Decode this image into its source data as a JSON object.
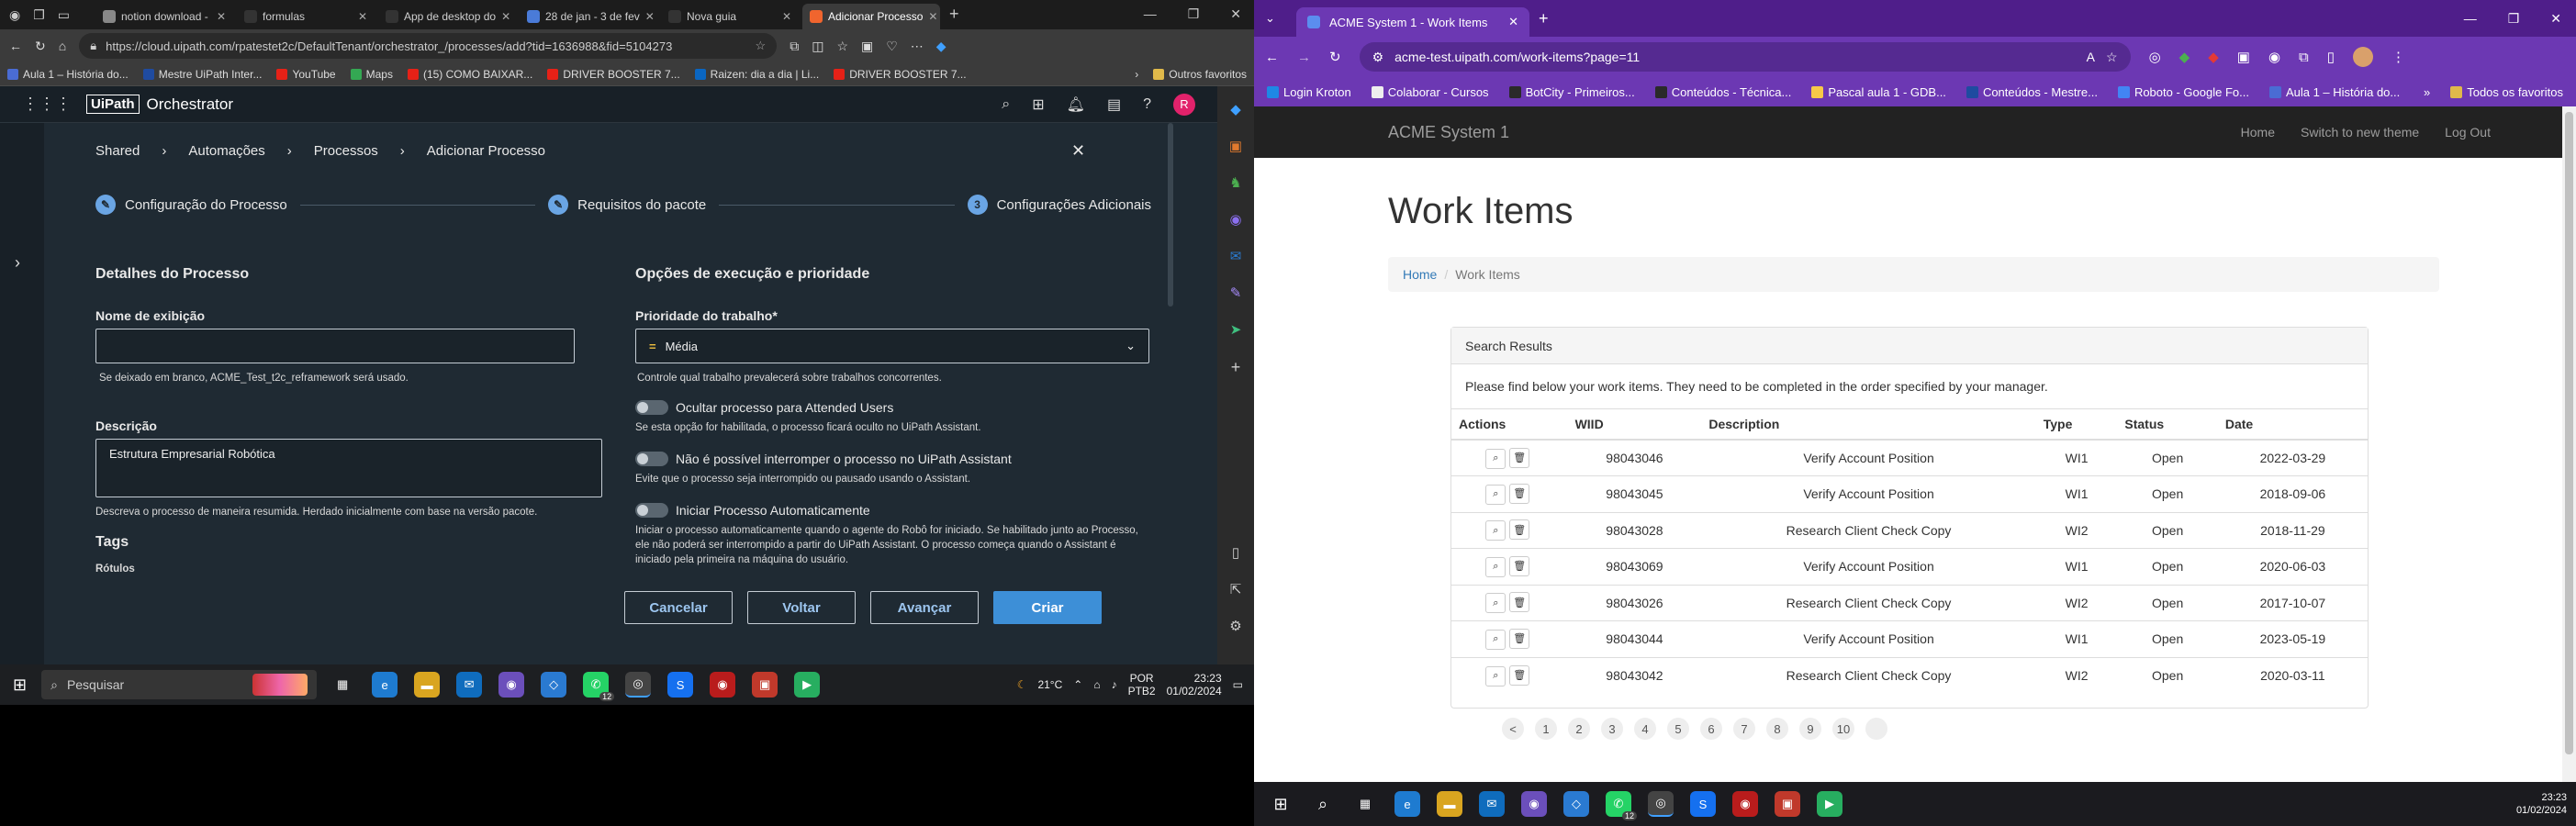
{
  "left": {
    "tabs": [
      {
        "label": "notion download -",
        "color": "#888888",
        "active": false
      },
      {
        "label": "formulas",
        "color": "#333333",
        "active": false
      },
      {
        "label": "App de desktop do",
        "color": "#333333",
        "active": false
      },
      {
        "label": "28 de jan - 3 de fev",
        "color": "#4a7bd8",
        "active": false
      },
      {
        "label": "Nova guia",
        "color": "#333333",
        "active": false
      },
      {
        "label": "Adicionar Processo",
        "color": "#f0652e",
        "active": true
      }
    ],
    "url": "https://cloud.uipath.com/rpatestet2c/DefaultTenant/orchestrator_/processes/add?tid=1636988&fid=5104273",
    "bookmarks": [
      {
        "label": "Aula 1 – História do...",
        "color": "#4a6cd4"
      },
      {
        "label": "Mestre UiPath Inter...",
        "color": "#1f4ba0"
      },
      {
        "label": "YouTube",
        "color": "#e62117"
      },
      {
        "label": "Maps",
        "color": "#34a853"
      },
      {
        "label": "(15) COMO BAIXAR...",
        "color": "#e62117"
      },
      {
        "label": "DRIVER BOOSTER 7...",
        "color": "#e62117"
      },
      {
        "label": "Raizen: dia a dia | Li...",
        "color": "#0a66c2"
      },
      {
        "label": "DRIVER BOOSTER 7...",
        "color": "#e62117"
      }
    ],
    "bookmarks_other": "Outros favoritos",
    "app_logo": "UiPath",
    "app_name": "Orchestrator",
    "avatar": "R",
    "breadcrumb": [
      "Shared",
      "Automações",
      "Processos",
      "Adicionar Processo"
    ],
    "steps": [
      {
        "label": "Configuração do Processo",
        "marker": "✎"
      },
      {
        "label": "Requisitos do pacote",
        "marker": "✎"
      },
      {
        "label": "Configurações Adicionais",
        "marker": "3"
      }
    ],
    "details_title": "Detalhes do Processo",
    "display_name_label": "Nome de exibição",
    "display_name_value": "",
    "display_name_help": "Se deixado em branco, ACME_Test_t2c_reframework será usado.",
    "description_label": "Descrição",
    "description_value": "Estrutura Empresarial Robótica",
    "description_help": "Descreva o processo de maneira resumida. Herdado inicialmente com base na versão pacote.",
    "tags_title": "Tags",
    "tags_cut": "Rótulos",
    "exec_title": "Opções de execução e prioridade",
    "priority_label": "Prioridade do trabalho*",
    "priority_icon": "=",
    "priority_value": "Média",
    "priority_help": "Controle qual trabalho prevalecerá sobre trabalhos concorrentes.",
    "toggles": [
      {
        "label": "Ocultar processo para Attended Users",
        "help": "Se esta opção for habilitada, o processo ficará oculto no UiPath Assistant."
      },
      {
        "label": "Não é possível interromper o processo no UiPath Assistant",
        "help": "Evite que o processo seja interrompido ou pausado usando o Assistant."
      },
      {
        "label": "Iniciar Processo Automaticamente",
        "help": "Iniciar o processo automaticamente quando o agente do Robô for iniciado. Se habilitado junto ao Processo, ele não poderá ser interrompido a partir do UiPath Assistant. O processo começa quando o Assistant é iniciado pela primeira na máquina do usuário."
      }
    ],
    "buttons": {
      "cancel": "Cancelar",
      "back": "Voltar",
      "next": "Avançar",
      "create": "Criar"
    },
    "taskbar": {
      "search": "Pesquisar",
      "weather": "21°C",
      "lang1": "POR",
      "lang2": "PTB2",
      "time": "23:23",
      "date": "01/02/2024",
      "badge": "12"
    }
  },
  "right": {
    "tab_title": "ACME System 1 - Work Items",
    "url": "acme-test.uipath.com/work-items?page=11",
    "bookmarks": [
      {
        "label": "Login Kroton",
        "color": "#1e88e5"
      },
      {
        "label": "Colaborar - Cursos",
        "color": "#eeeeee"
      },
      {
        "label": "BotCity - Primeiros...",
        "color": "#2a2a2a"
      },
      {
        "label": "Conteúdos - Técnica...",
        "color": "#2a2a2a"
      },
      {
        "label": "Pascal aula 1 - GDB...",
        "color": "#f7c948"
      },
      {
        "label": "Conteúdos - Mestre...",
        "color": "#1f4ba0"
      },
      {
        "label": "Roboto - Google Fo...",
        "color": "#4285f4"
      },
      {
        "label": "Aula 1 – História do...",
        "color": "#4a6cd4"
      }
    ],
    "bookmarks_other": "Todos os favoritos",
    "brand": "ACME System 1",
    "nav": [
      "Home",
      "Switch to new theme",
      "Log Out"
    ],
    "title": "Work Items",
    "breadcrumb": [
      "Home",
      "Work Items"
    ],
    "panel_heading": "Search Results",
    "panel_text": "Please find below your work items. They need to be completed in the order specified by your manager.",
    "columns": [
      "Actions",
      "WIID",
      "Description",
      "Type",
      "Status",
      "Date"
    ],
    "rows": [
      {
        "wiid": "98043046",
        "desc": "Verify Account Position",
        "type": "WI1",
        "status": "Open",
        "date": "2022-03-29"
      },
      {
        "wiid": "98043045",
        "desc": "Verify Account Position",
        "type": "WI1",
        "status": "Open",
        "date": "2018-09-06"
      },
      {
        "wiid": "98043028",
        "desc": "Research Client Check Copy",
        "type": "WI2",
        "status": "Open",
        "date": "2018-11-29"
      },
      {
        "wiid": "98043069",
        "desc": "Verify Account Position",
        "type": "WI1",
        "status": "Open",
        "date": "2020-06-03"
      },
      {
        "wiid": "98043026",
        "desc": "Research Client Check Copy",
        "type": "WI2",
        "status": "Open",
        "date": "2017-10-07"
      },
      {
        "wiid": "98043044",
        "desc": "Verify Account Position",
        "type": "WI1",
        "status": "Open",
        "date": "2023-05-19"
      },
      {
        "wiid": "98043042",
        "desc": "Research Client Check Copy",
        "type": "WI2",
        "status": "Open",
        "date": "2020-03-11"
      }
    ],
    "pages": [
      "<",
      "1",
      "2",
      "3",
      "4",
      "5",
      "6",
      "7",
      "8",
      "9",
      "10",
      ""
    ],
    "taskbar": {
      "time": "23:23",
      "date": "01/02/2024",
      "badge": "12"
    }
  }
}
